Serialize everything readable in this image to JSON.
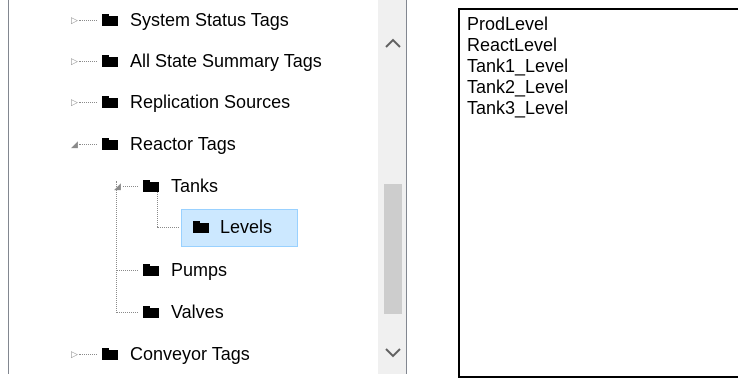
{
  "tree": {
    "nodes": [
      {
        "label": "System Status Tags",
        "state": "collapsed"
      },
      {
        "label": "All State Summary Tags",
        "state": "collapsed"
      },
      {
        "label": "Replication Sources",
        "state": "collapsed"
      },
      {
        "label": "Reactor Tags",
        "state": "expanded"
      },
      {
        "label": "Tanks",
        "state": "expanded"
      },
      {
        "label": "Levels",
        "state": "selected"
      },
      {
        "label": "Pumps",
        "state": "leaf"
      },
      {
        "label": "Valves",
        "state": "leaf"
      },
      {
        "label": "Conveyor Tags",
        "state": "collapsed"
      }
    ],
    "scrollbar": {
      "up_icon": "chevron-up-icon",
      "down_icon": "chevron-down-icon"
    }
  },
  "tags": {
    "items": [
      "ProdLevel",
      "ReactLevel",
      "Tank1_Level",
      "Tank2_Level",
      "Tank3_Level"
    ]
  }
}
